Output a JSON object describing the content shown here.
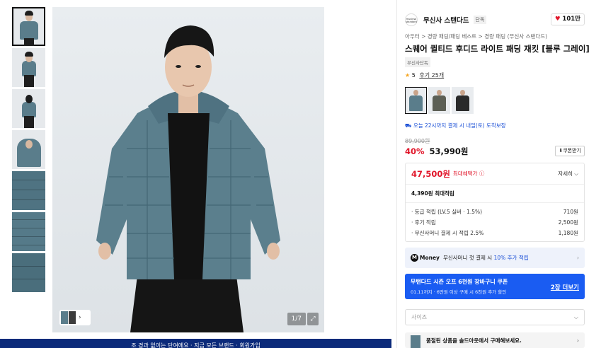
{
  "gallery": {
    "counter": "1/7",
    "expand_icon": "expand-icon",
    "next_icon": "chevron-right-icon"
  },
  "banner": {
    "text": "조 경과 없이는 단여에요 · 지금 모든 브랜드 · 회원가입"
  },
  "brand": {
    "logo_text": "musinsa standard",
    "name": "무신사 스탠다드",
    "badge": "단독",
    "likes": "101만"
  },
  "product": {
    "breadcrumb": "아우터 > 경량 패딩/패딩 베스트 > 경량 패딩 (무신사 스탠다드)",
    "title": "스퀘어 퀼티드 후디드 라이트 패딩 재킷 [블루 그레이]",
    "exclusive_tag": "무신사단독",
    "rating": "5",
    "review_link": "후기 25개",
    "delivery": "오늘 22시까지 결제 시 내일(토) 도착보장"
  },
  "colors": [
    {
      "name": "blue-gray",
      "hex": "#5a7d8b"
    },
    {
      "name": "khaki",
      "hex": "#5c5f55"
    },
    {
      "name": "black",
      "hex": "#2a2a2a"
    }
  ],
  "price": {
    "original": "89,900원",
    "discount": "40%",
    "sale": "53,990원",
    "coupon_button": "⬇쿠폰받기"
  },
  "benefit": {
    "max_price": "47,500원",
    "max_label": "최대혜택가 ⓘ",
    "detail_link": "자세히 ⌵",
    "points_total": "4,390원 최대적립",
    "rows": [
      {
        "label": "· 등급 적립 (LV.5 실버 · 1.5%)",
        "value": "710원"
      },
      {
        "label": "· 후기 적립",
        "value": "2,500원"
      },
      {
        "label": "· 무신사머니 결제 시 적립 2.5%",
        "value": "1,180원"
      }
    ]
  },
  "money": {
    "icon": "M",
    "label": "Money",
    "text_prefix": "무신사머니 첫 결제 시",
    "highlight": "10% 추가 적립"
  },
  "coupon_bar": {
    "title": "무탠다드 시즌 오프 6천원 장바구니 쿠폰",
    "subtitle": "01.11까지 · 6만원 이상 구매 시 6천원 추가 할인",
    "link": "2장 더보기"
  },
  "size": {
    "placeholder": "사이즈"
  },
  "soldout": {
    "text": "품절된 상품을 솔드아웃에서 구매해보세요."
  },
  "accent": {
    "red": "#e1162a",
    "blue": "#1a5cf2",
    "link_blue": "#1a4fd6",
    "jacket": "#5a7d8b",
    "banner": "#0b2a7a"
  }
}
